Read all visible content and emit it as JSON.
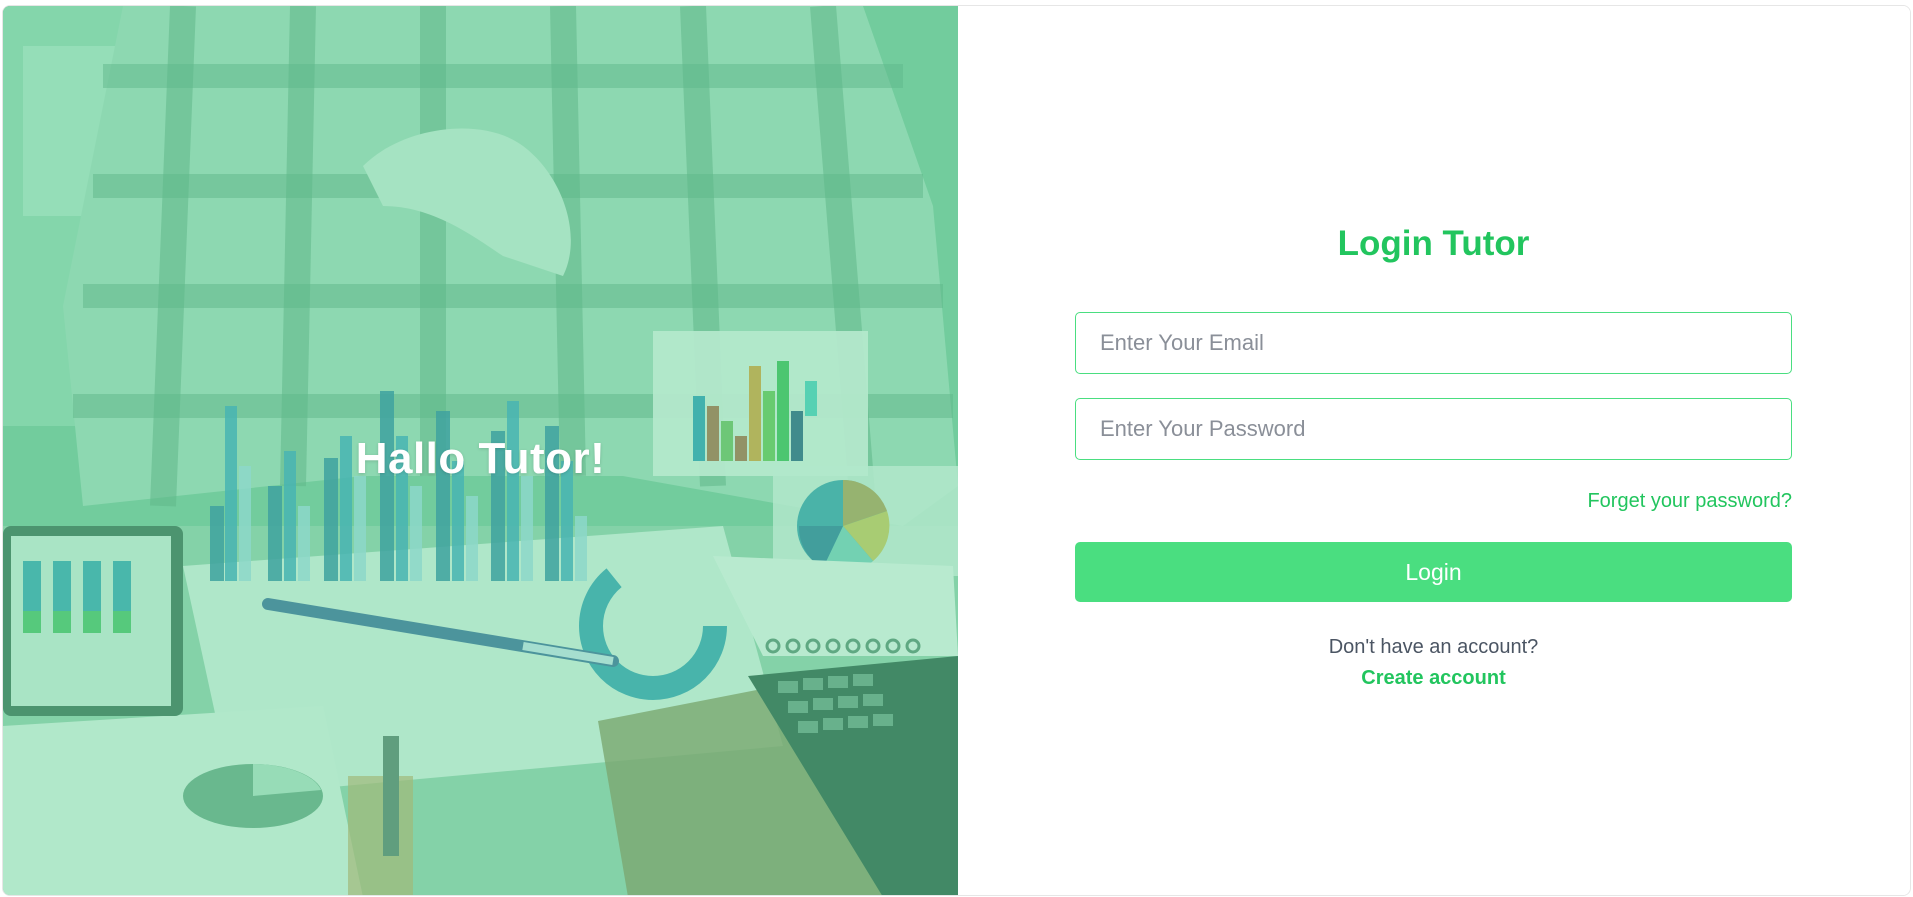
{
  "hero": {
    "greeting": "Hallo Tutor!",
    "image": "person-with-financial-charts-photo"
  },
  "form": {
    "title": "Login Tutor",
    "email_placeholder": "Enter Your Email",
    "password_placeholder": "Enter Your Password",
    "forgot_label": "Forget your password?",
    "login_label": "Login",
    "no_account_text": "Don't have an account?",
    "create_label": "Create account"
  },
  "colors": {
    "accent": "#22c55e",
    "button": "#4ade80",
    "hero_overlay": "#62d296"
  }
}
